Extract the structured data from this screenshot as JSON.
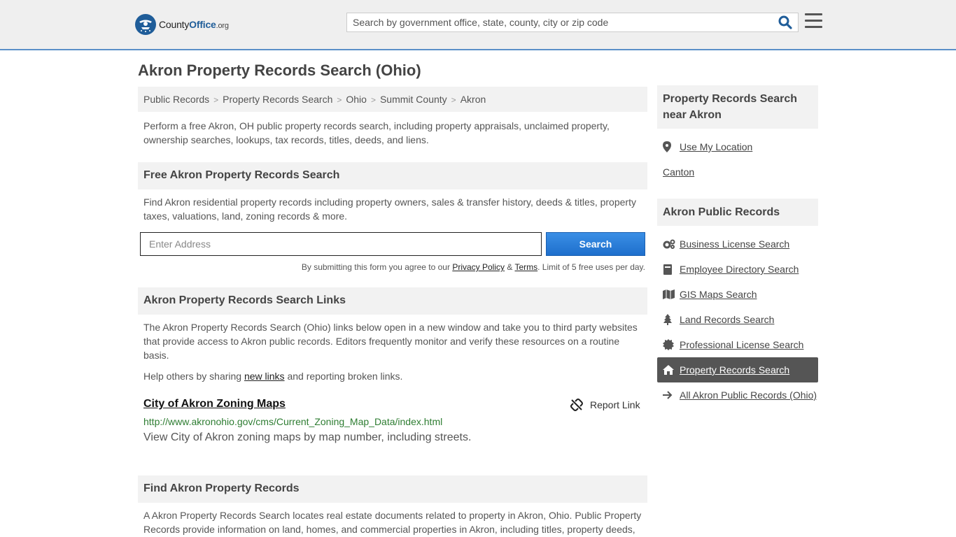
{
  "header": {
    "logo_brand": "County",
    "logo_office": "Office",
    "logo_org": ".org",
    "search_placeholder": "Search by government office, state, county, city or zip code"
  },
  "page": {
    "title": "Akron Property Records Search (Ohio)",
    "breadcrumb": [
      "Public Records",
      "Property Records Search",
      "Ohio",
      "Summit County",
      "Akron"
    ],
    "intro": "Perform a free Akron, OH public property records search, including property appraisals, unclaimed property, ownership searches, lookups, tax records, titles, deeds, and liens."
  },
  "free_search": {
    "heading": "Free Akron Property Records Search",
    "description": "Find Akron residential property records including property owners, sales & transfer history, deeds & titles, property taxes, valuations, land, zoning records & more.",
    "address_placeholder": "Enter Address",
    "button_label": "Search",
    "terms_prefix": "By submitting this form you agree to our ",
    "privacy_label": "Privacy Policy",
    "terms_amp": " & ",
    "terms_label": "Terms",
    "terms_suffix": ". Limit of 5 free uses per day."
  },
  "links_section": {
    "heading": "Akron Property Records Search Links",
    "description": "The Akron Property Records Search (Ohio) links below open in a new window and take you to third party websites that provide access to Akron public records. Editors frequently monitor and verify these resources on a routine basis.",
    "help_prefix": "Help others by sharing ",
    "help_link": "new links",
    "help_suffix": " and reporting broken links.",
    "links": [
      {
        "title": "City of Akron Zoning Maps",
        "url": "http://www.akronohio.gov/cms/Current_Zoning_Map_Data/index.html",
        "description": "View City of Akron zoning maps by map number, including streets.",
        "report_label": "Report Link"
      }
    ]
  },
  "find_section": {
    "heading": "Find Akron Property Records",
    "description": "A Akron Property Records Search locates real estate documents related to property in Akron, Ohio. Public Property Records provide information on land, homes, and commercial properties in Akron, including titles, property deeds,"
  },
  "sidebar": {
    "near_heading": "Property Records Search near Akron",
    "use_location": "Use My Location",
    "nearby": [
      "Canton"
    ],
    "public_heading": "Akron Public Records",
    "items": [
      {
        "label": "Business License Search",
        "icon": "cogs-icon"
      },
      {
        "label": "Employee Directory Search",
        "icon": "book-icon"
      },
      {
        "label": "GIS Maps Search",
        "icon": "map-icon"
      },
      {
        "label": "Land Records Search",
        "icon": "tree-icon"
      },
      {
        "label": "Professional License Search",
        "icon": "certificate-icon"
      },
      {
        "label": "Property Records Search",
        "icon": "home-icon",
        "active": true
      },
      {
        "label": "All Akron Public Records (Ohio)",
        "icon": "arrow-right-icon"
      }
    ]
  },
  "colors": {
    "accent_blue": "#1f5d99",
    "button_blue": "#2a7ad8",
    "url_green": "#2e7d32",
    "active_bg": "#555555"
  }
}
